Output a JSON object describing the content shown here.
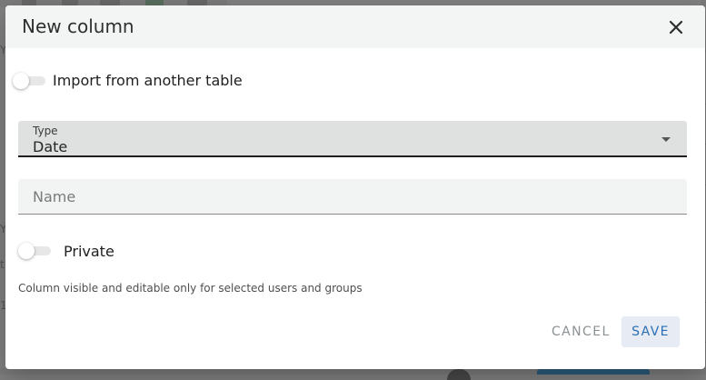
{
  "dialog": {
    "title": "New column",
    "close_icon": "close-icon"
  },
  "import_toggle": {
    "label": "Import from another table",
    "checked": false
  },
  "type_select": {
    "caption": "Type",
    "value": "Date"
  },
  "name_field": {
    "placeholder": "Name",
    "value": ""
  },
  "private_toggle": {
    "label": "Private",
    "checked": false
  },
  "helper_text": "Column visible and editable only for selected users and groups",
  "actions": {
    "cancel_label": "CANCEL",
    "save_label": "SAVE"
  },
  "colors": {
    "overlay": "#808080",
    "dialog_header": "#f3f4f4",
    "select_bg": "#dfe1e1",
    "primary": "#2a6fb3",
    "save_bg": "#e7ecf4",
    "cancel_text": "#8c9194"
  }
}
